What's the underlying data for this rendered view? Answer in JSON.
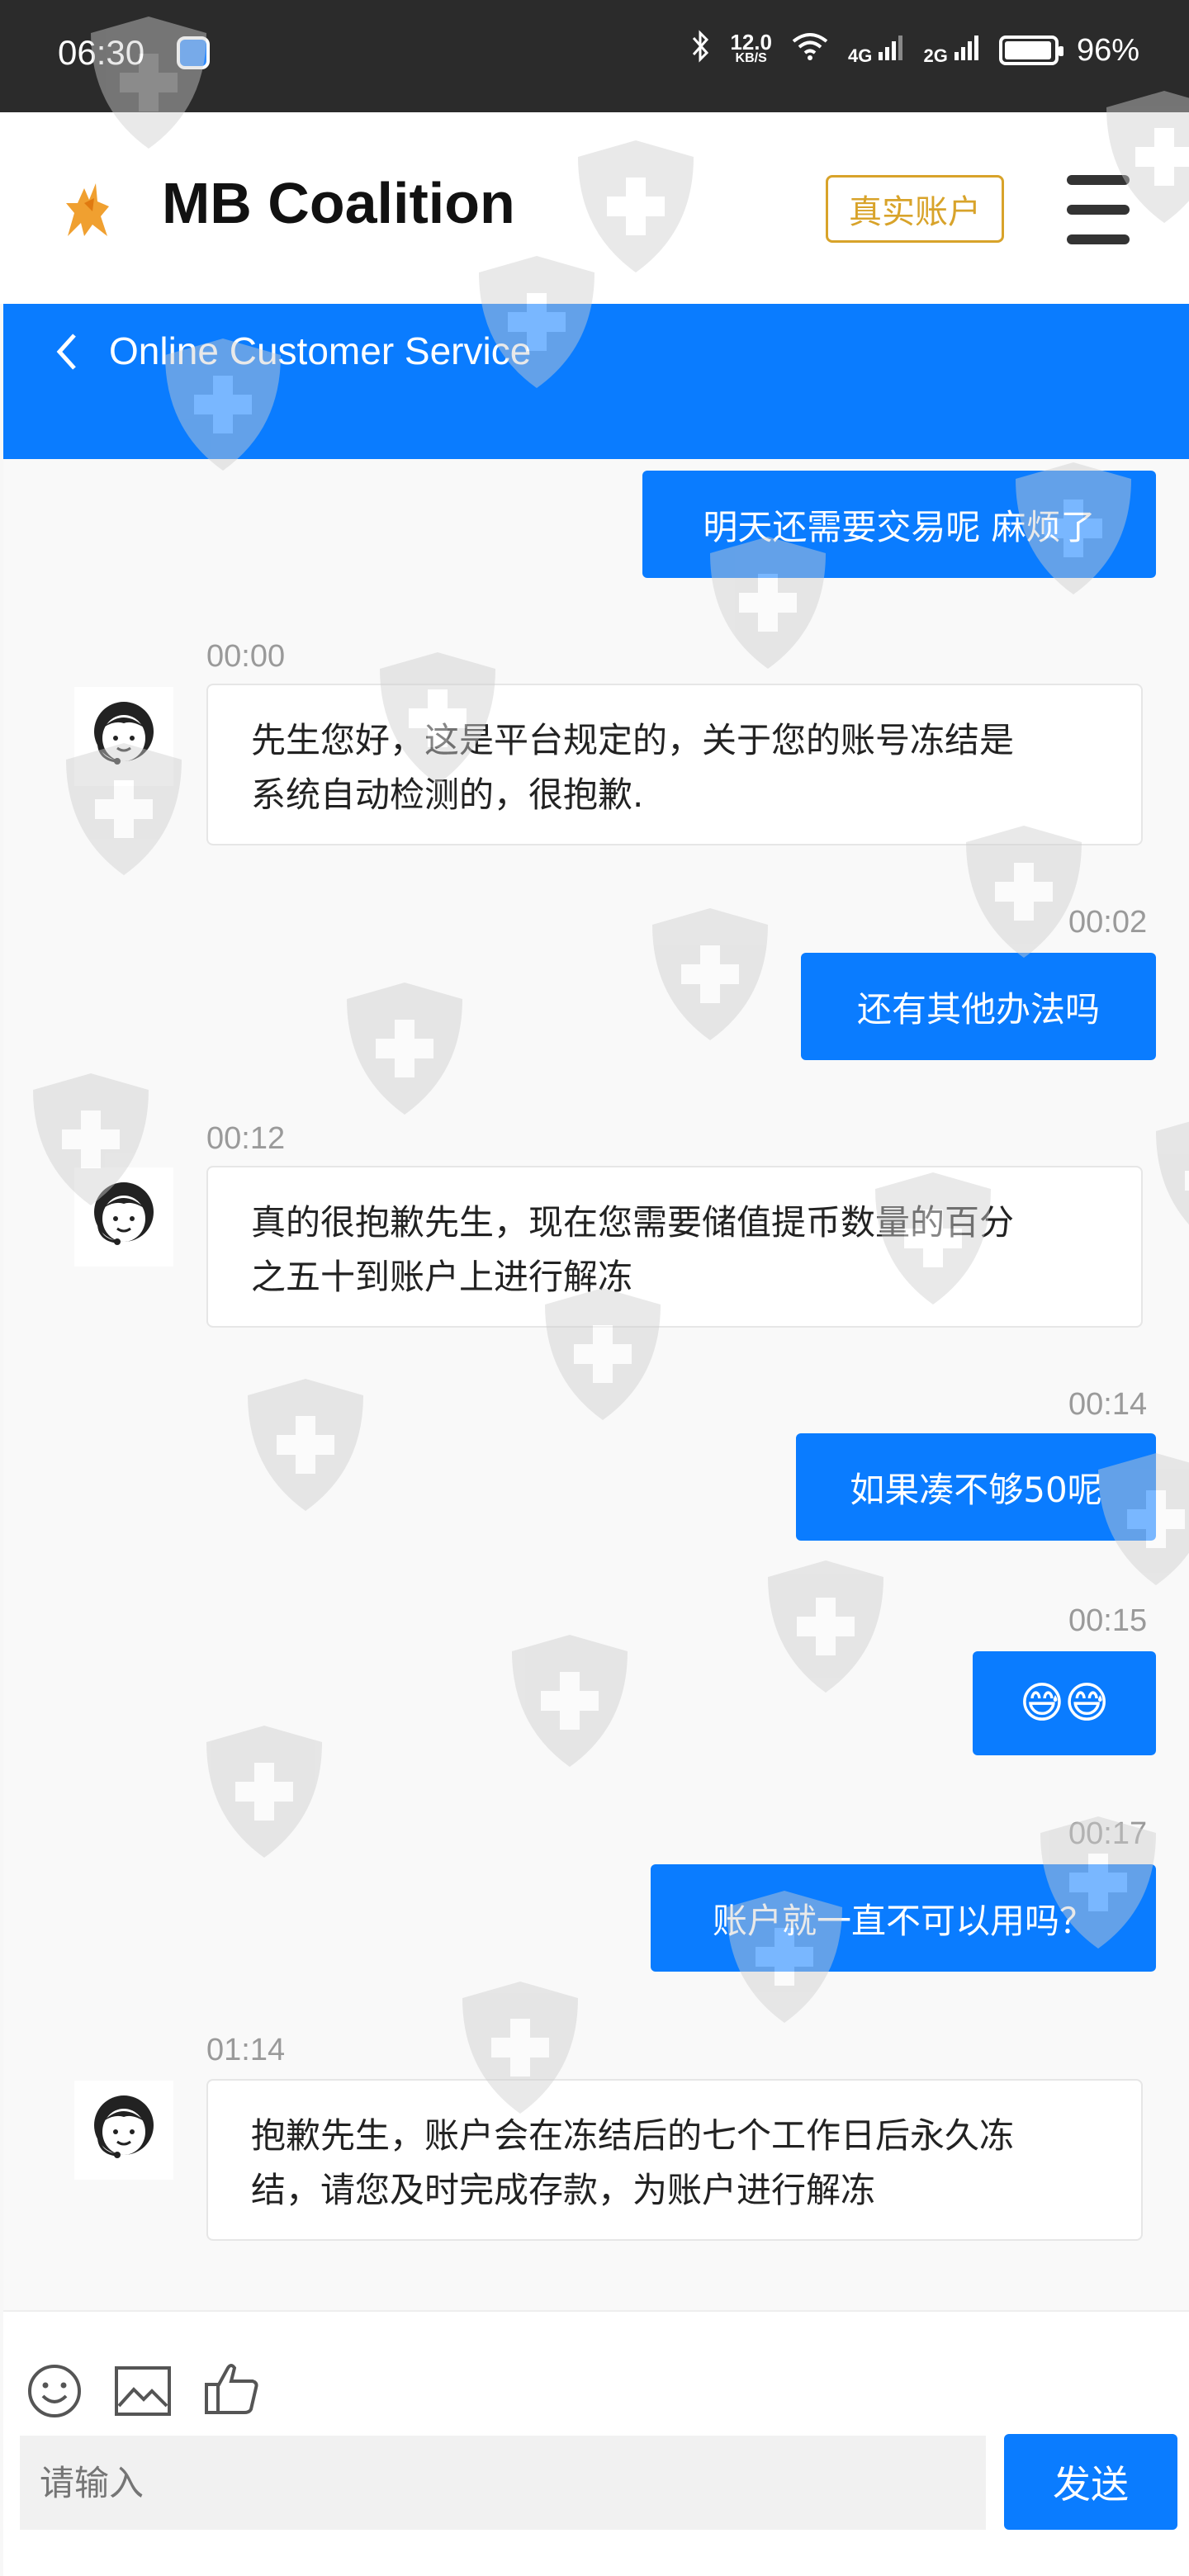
{
  "status_bar": {
    "time": "06:30",
    "net_speed_value": "12.0",
    "net_speed_unit": "KB/S",
    "sim1": "4G",
    "sim2": "2G",
    "battery": "96%",
    "battery_level": 0.96
  },
  "header": {
    "brand": "MB Coalition",
    "real_account": "真实账户",
    "accent_color": "#d8a32a"
  },
  "service_bar": {
    "title": "Online Customer Service",
    "color": "#0a7cff"
  },
  "messages": [
    {
      "side": "right",
      "time": "",
      "text": "明天还需要交易呢 麻烦了"
    },
    {
      "side": "left",
      "time": "00:00",
      "lines": [
        "先生您好，这是平台规定的，关于您的账号冻结是",
        "系统自动检测的，很抱歉."
      ]
    },
    {
      "side": "right",
      "time": "00:02",
      "text": "还有其他办法吗"
    },
    {
      "side": "left",
      "time": "00:12",
      "lines": [
        "真的很抱歉先生，现在您需要储值提币数量的百分",
        "之五十到账户上进行解冻"
      ]
    },
    {
      "side": "right",
      "time": "00:14",
      "text": "如果凑不够50呢"
    },
    {
      "side": "right",
      "time": "00:15",
      "text": "😅😅"
    },
    {
      "side": "right",
      "time": "00:17",
      "text": "账户就一直不可以用吗？"
    },
    {
      "side": "left",
      "time": "01:14",
      "lines": [
        "抱歉先生，账户会在冻结后的七个工作日后永久冻",
        "结，请您及时完成存款，为账户进行解冻"
      ]
    }
  ],
  "input": {
    "placeholder": "请输入",
    "send_label": "发送",
    "tools": [
      "emoji-icon",
      "image-icon",
      "thumbs-up-icon"
    ]
  }
}
